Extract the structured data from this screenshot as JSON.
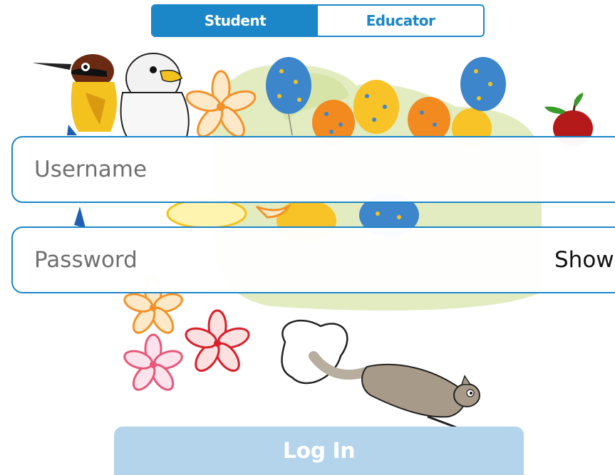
{
  "role_toggle": {
    "student_label": "Student",
    "educator_label": "Educator",
    "selected": "Student"
  },
  "form": {
    "username_placeholder": "Username",
    "password_placeholder": "Password",
    "show_label": "Show",
    "login_label": "Log In"
  },
  "colors": {
    "accent": "#1b86c8",
    "login_disabled": "#b4d4ec"
  },
  "illustration": {
    "icons": [
      "bird-icon",
      "eagle-icon",
      "flower-icon",
      "balloon-icon",
      "apple-icon",
      "squirrel-icon"
    ]
  }
}
